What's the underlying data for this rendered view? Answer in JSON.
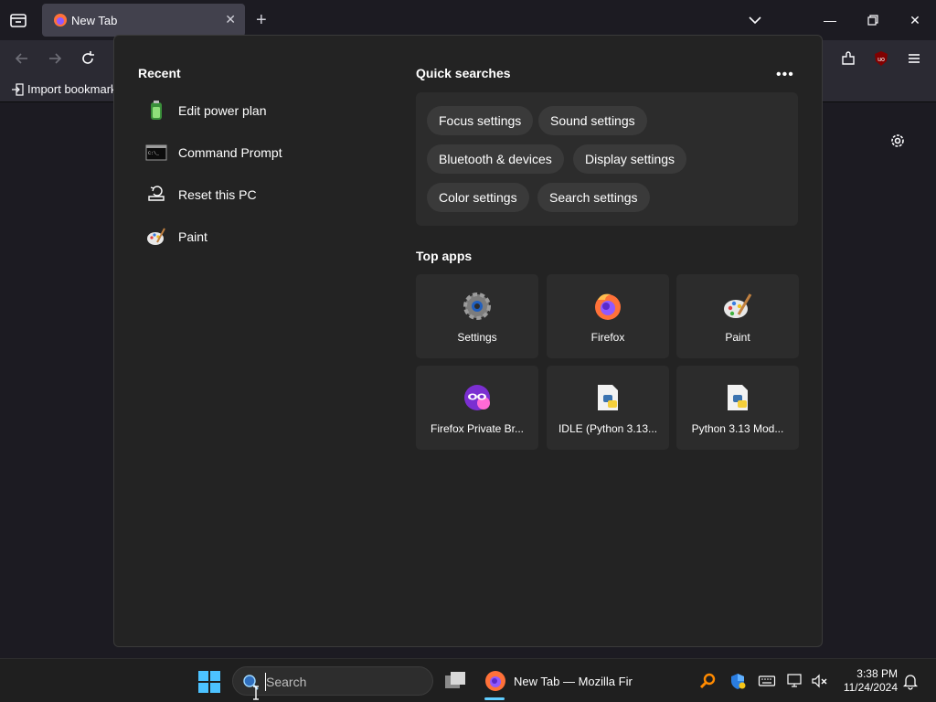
{
  "browser": {
    "tab_title": "New Tab",
    "bookmark_import_label": "Import bookmark"
  },
  "flyout": {
    "recent_title": "Recent",
    "recent_items": [
      {
        "label": "Edit power plan",
        "icon": "power-plan-icon"
      },
      {
        "label": "Command Prompt",
        "icon": "command-prompt-icon"
      },
      {
        "label": "Reset this PC",
        "icon": "reset-pc-icon"
      },
      {
        "label": "Paint",
        "icon": "paint-icon"
      }
    ],
    "quick_searches_title": "Quick searches",
    "quick_searches": [
      "Focus settings",
      "Sound settings",
      "Bluetooth & devices",
      "Display settings",
      "Color settings",
      "Search settings"
    ],
    "top_apps_title": "Top apps",
    "top_apps": [
      {
        "label": "Settings",
        "icon": "settings-icon"
      },
      {
        "label": "Firefox",
        "icon": "firefox-icon"
      },
      {
        "label": "Paint",
        "icon": "paint-icon"
      },
      {
        "label": "Firefox Private Br...",
        "icon": "firefox-private-icon"
      },
      {
        "label": "IDLE (Python 3.13...",
        "icon": "python-idle-icon"
      },
      {
        "label": "Python 3.13 Mod...",
        "icon": "python-module-icon"
      }
    ]
  },
  "taskbar": {
    "search_placeholder": "Search",
    "firefox_window_title": "New Tab — Mozilla Fire",
    "time": "3:38 PM",
    "date": "11/24/2024"
  },
  "colors": {
    "accent": "#60cdff",
    "flyout_bg": "#232323",
    "chip_bg": "#3a3a3a"
  }
}
